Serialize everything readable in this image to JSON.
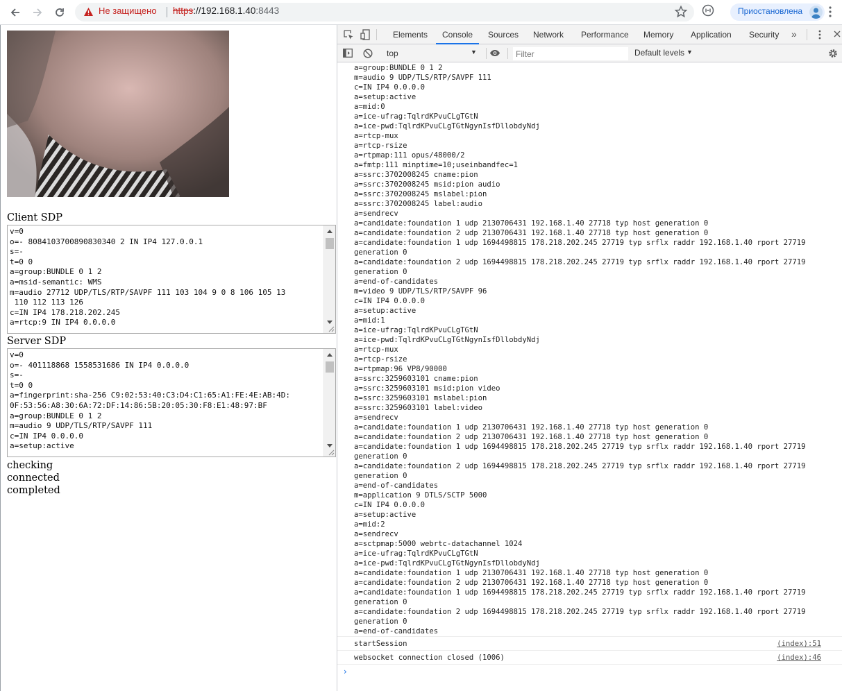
{
  "browser": {
    "security_label": "Не защищено",
    "url_scheme": "https",
    "url_host": "://192.168.1.40",
    "url_rest": ":8443",
    "profile_label": "Приостановлена"
  },
  "page": {
    "client_sdp_label": "Client SDP",
    "client_sdp": "v=0\no=- 8084103700890830340 2 IN IP4 127.0.0.1\ns=-\nt=0 0\na=group:BUNDLE 0 1 2\na=msid-semantic: WMS\nm=audio 27712 UDP/TLS/RTP/SAVPF 111 103 104 9 0 8 106 105 13\n 110 112 113 126\nc=IN IP4 178.218.202.245\na=rtcp:9 IN IP4 0.0.0.0",
    "server_sdp_label": "Server SDP",
    "server_sdp": "v=0\no=- 401118868 1558531686 IN IP4 0.0.0.0\ns=-\nt=0 0\na=fingerprint:sha-256 C9:02:53:40:C3:D4:C1:65:A1:FE:4E:AB:4D:\n0F:53:56:A8:30:6A:72:DF:14:86:5B:20:05:30:F8:E1:48:97:BF\na=group:BUNDLE 0 1 2\nm=audio 9 UDP/TLS/RTP/SAVPF 111\nc=IN IP4 0.0.0.0\na=setup:active",
    "states": [
      "checking",
      "connected",
      "completed"
    ]
  },
  "devtools": {
    "tabs": [
      "Elements",
      "Console",
      "Sources",
      "Network",
      "Performance",
      "Memory",
      "Application",
      "Security"
    ],
    "active_tab": "Console",
    "more_label": "»",
    "context": "top",
    "filter_placeholder": "Filter",
    "levels_label": "Default levels",
    "log_text": "a=group:BUNDLE 0 1 2\nm=audio 9 UDP/TLS/RTP/SAVPF 111\nc=IN IP4 0.0.0.0\na=setup:active\na=mid:0\na=ice-ufrag:TqlrdKPvuCLgTGtN\na=ice-pwd:TqlrdKPvuCLgTGtNgynIsfDllobdyNdj\na=rtcp-mux\na=rtcp-rsize\na=rtpmap:111 opus/48000/2\na=fmtp:111 minptime=10;useinbandfec=1\na=ssrc:3702008245 cname:pion\na=ssrc:3702008245 msid:pion audio\na=ssrc:3702008245 mslabel:pion\na=ssrc:3702008245 label:audio\na=sendrecv\na=candidate:foundation 1 udp 2130706431 192.168.1.40 27718 typ host generation 0\na=candidate:foundation 2 udp 2130706431 192.168.1.40 27718 typ host generation 0\na=candidate:foundation 1 udp 1694498815 178.218.202.245 27719 typ srflx raddr 192.168.1.40 rport 27719\ngeneration 0\na=candidate:foundation 2 udp 1694498815 178.218.202.245 27719 typ srflx raddr 192.168.1.40 rport 27719\ngeneration 0\na=end-of-candidates\nm=video 9 UDP/TLS/RTP/SAVPF 96\nc=IN IP4 0.0.0.0\na=setup:active\na=mid:1\na=ice-ufrag:TqlrdKPvuCLgTGtN\na=ice-pwd:TqlrdKPvuCLgTGtNgynIsfDllobdyNdj\na=rtcp-mux\na=rtcp-rsize\na=rtpmap:96 VP8/90000\na=ssrc:3259603101 cname:pion\na=ssrc:3259603101 msid:pion video\na=ssrc:3259603101 mslabel:pion\na=ssrc:3259603101 label:video\na=sendrecv\na=candidate:foundation 1 udp 2130706431 192.168.1.40 27718 typ host generation 0\na=candidate:foundation 2 udp 2130706431 192.168.1.40 27718 typ host generation 0\na=candidate:foundation 1 udp 1694498815 178.218.202.245 27719 typ srflx raddr 192.168.1.40 rport 27719\ngeneration 0\na=candidate:foundation 2 udp 1694498815 178.218.202.245 27719 typ srflx raddr 192.168.1.40 rport 27719\ngeneration 0\na=end-of-candidates\nm=application 9 DTLS/SCTP 5000\nc=IN IP4 0.0.0.0\na=setup:active\na=mid:2\na=sendrecv\na=sctpmap:5000 webrtc-datachannel 1024\na=ice-ufrag:TqlrdKPvuCLgTGtN\na=ice-pwd:TqlrdKPvuCLgTGtNgynIsfDllobdyNdj\na=candidate:foundation 1 udp 2130706431 192.168.1.40 27718 typ host generation 0\na=candidate:foundation 2 udp 2130706431 192.168.1.40 27718 typ host generation 0\na=candidate:foundation 1 udp 1694498815 178.218.202.245 27719 typ srflx raddr 192.168.1.40 rport 27719\ngeneration 0\na=candidate:foundation 2 udp 1694498815 178.218.202.245 27719 typ srflx raddr 192.168.1.40 rport 27719\ngeneration 0\na=end-of-candidates",
    "messages": [
      {
        "text": "startSession",
        "source": "(index):51"
      },
      {
        "text": "websocket connection closed (1006)",
        "source": "(index):46"
      }
    ],
    "prompt": "›"
  }
}
